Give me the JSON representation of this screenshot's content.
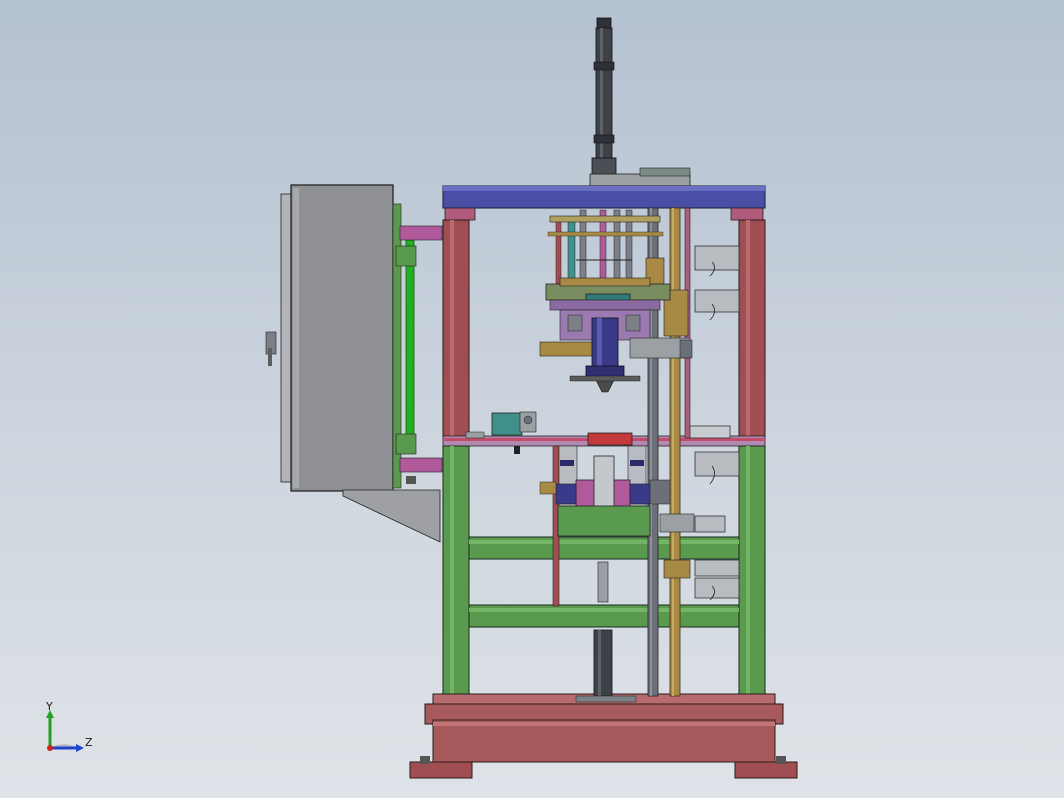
{
  "viewport": {
    "background_top": "#b4c1d1",
    "background_bottom": "#dfe3e8"
  },
  "triad": {
    "x_label": "Y",
    "z_label": "Z"
  },
  "colors": {
    "frame_red": "#a04e52",
    "frame_green": "#5a9a4e",
    "top_plate_blue": "#4a4fa6",
    "cabinet_gray": "#8e9093",
    "base_red": "#a8595b",
    "cylinder_dark": "#3e4147",
    "brass": "#a88a45",
    "magenta": "#b05a9c",
    "teal": "#3f8f8a",
    "bright_green": "#22b022"
  }
}
